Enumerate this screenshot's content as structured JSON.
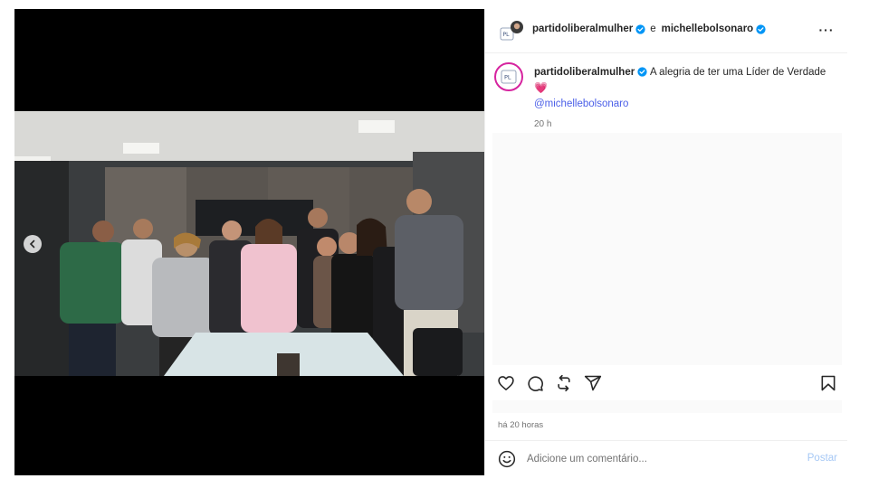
{
  "media": {
    "prev_icon": "chevron-left-icon"
  },
  "header": {
    "author": "partidoliberalmulher",
    "joiner": "e",
    "coauthor": "michellebolsonaro",
    "verified_icon": "verified-badge-icon",
    "more_icon": "more-horizontal-icon",
    "more_label": "···"
  },
  "caption": {
    "username": "partidoliberalmulher",
    "text": "A alegria de ter uma Líder de Verdade",
    "emoji": "💗",
    "mention": "@michellebolsonaro",
    "time": "20 h"
  },
  "actions": {
    "like_icon": "heart-icon",
    "comment_icon": "comment-icon",
    "repost_icon": "repost-icon",
    "share_icon": "share-icon",
    "save_icon": "bookmark-icon"
  },
  "date_text": "há 20 horas",
  "comment": {
    "emoji_icon": "smiley-icon",
    "placeholder": "Adicione um comentário...",
    "value": "",
    "post_label": "Postar"
  },
  "colors": {
    "accent_link": "#4b5fe8",
    "verified": "#0095f6",
    "post_button_disabled": "#a6c8f5",
    "story_ring": "#d6249f"
  }
}
